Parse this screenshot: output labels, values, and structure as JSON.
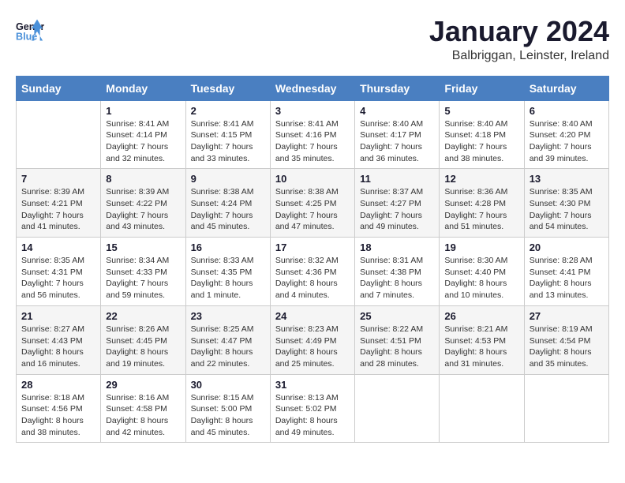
{
  "header": {
    "logo_line1": "General",
    "logo_line2": "Blue",
    "title": "January 2024",
    "subtitle": "Balbriggan, Leinster, Ireland"
  },
  "columns": [
    "Sunday",
    "Monday",
    "Tuesday",
    "Wednesday",
    "Thursday",
    "Friday",
    "Saturday"
  ],
  "weeks": [
    [
      {
        "day": "",
        "sunrise": "",
        "sunset": "",
        "daylight": ""
      },
      {
        "day": "1",
        "sunrise": "Sunrise: 8:41 AM",
        "sunset": "Sunset: 4:14 PM",
        "daylight": "Daylight: 7 hours and 32 minutes."
      },
      {
        "day": "2",
        "sunrise": "Sunrise: 8:41 AM",
        "sunset": "Sunset: 4:15 PM",
        "daylight": "Daylight: 7 hours and 33 minutes."
      },
      {
        "day": "3",
        "sunrise": "Sunrise: 8:41 AM",
        "sunset": "Sunset: 4:16 PM",
        "daylight": "Daylight: 7 hours and 35 minutes."
      },
      {
        "day": "4",
        "sunrise": "Sunrise: 8:40 AM",
        "sunset": "Sunset: 4:17 PM",
        "daylight": "Daylight: 7 hours and 36 minutes."
      },
      {
        "day": "5",
        "sunrise": "Sunrise: 8:40 AM",
        "sunset": "Sunset: 4:18 PM",
        "daylight": "Daylight: 7 hours and 38 minutes."
      },
      {
        "day": "6",
        "sunrise": "Sunrise: 8:40 AM",
        "sunset": "Sunset: 4:20 PM",
        "daylight": "Daylight: 7 hours and 39 minutes."
      }
    ],
    [
      {
        "day": "7",
        "sunrise": "Sunrise: 8:39 AM",
        "sunset": "Sunset: 4:21 PM",
        "daylight": "Daylight: 7 hours and 41 minutes."
      },
      {
        "day": "8",
        "sunrise": "Sunrise: 8:39 AM",
        "sunset": "Sunset: 4:22 PM",
        "daylight": "Daylight: 7 hours and 43 minutes."
      },
      {
        "day": "9",
        "sunrise": "Sunrise: 8:38 AM",
        "sunset": "Sunset: 4:24 PM",
        "daylight": "Daylight: 7 hours and 45 minutes."
      },
      {
        "day": "10",
        "sunrise": "Sunrise: 8:38 AM",
        "sunset": "Sunset: 4:25 PM",
        "daylight": "Daylight: 7 hours and 47 minutes."
      },
      {
        "day": "11",
        "sunrise": "Sunrise: 8:37 AM",
        "sunset": "Sunset: 4:27 PM",
        "daylight": "Daylight: 7 hours and 49 minutes."
      },
      {
        "day": "12",
        "sunrise": "Sunrise: 8:36 AM",
        "sunset": "Sunset: 4:28 PM",
        "daylight": "Daylight: 7 hours and 51 minutes."
      },
      {
        "day": "13",
        "sunrise": "Sunrise: 8:35 AM",
        "sunset": "Sunset: 4:30 PM",
        "daylight": "Daylight: 7 hours and 54 minutes."
      }
    ],
    [
      {
        "day": "14",
        "sunrise": "Sunrise: 8:35 AM",
        "sunset": "Sunset: 4:31 PM",
        "daylight": "Daylight: 7 hours and 56 minutes."
      },
      {
        "day": "15",
        "sunrise": "Sunrise: 8:34 AM",
        "sunset": "Sunset: 4:33 PM",
        "daylight": "Daylight: 7 hours and 59 minutes."
      },
      {
        "day": "16",
        "sunrise": "Sunrise: 8:33 AM",
        "sunset": "Sunset: 4:35 PM",
        "daylight": "Daylight: 8 hours and 1 minute."
      },
      {
        "day": "17",
        "sunrise": "Sunrise: 8:32 AM",
        "sunset": "Sunset: 4:36 PM",
        "daylight": "Daylight: 8 hours and 4 minutes."
      },
      {
        "day": "18",
        "sunrise": "Sunrise: 8:31 AM",
        "sunset": "Sunset: 4:38 PM",
        "daylight": "Daylight: 8 hours and 7 minutes."
      },
      {
        "day": "19",
        "sunrise": "Sunrise: 8:30 AM",
        "sunset": "Sunset: 4:40 PM",
        "daylight": "Daylight: 8 hours and 10 minutes."
      },
      {
        "day": "20",
        "sunrise": "Sunrise: 8:28 AM",
        "sunset": "Sunset: 4:41 PM",
        "daylight": "Daylight: 8 hours and 13 minutes."
      }
    ],
    [
      {
        "day": "21",
        "sunrise": "Sunrise: 8:27 AM",
        "sunset": "Sunset: 4:43 PM",
        "daylight": "Daylight: 8 hours and 16 minutes."
      },
      {
        "day": "22",
        "sunrise": "Sunrise: 8:26 AM",
        "sunset": "Sunset: 4:45 PM",
        "daylight": "Daylight: 8 hours and 19 minutes."
      },
      {
        "day": "23",
        "sunrise": "Sunrise: 8:25 AM",
        "sunset": "Sunset: 4:47 PM",
        "daylight": "Daylight: 8 hours and 22 minutes."
      },
      {
        "day": "24",
        "sunrise": "Sunrise: 8:23 AM",
        "sunset": "Sunset: 4:49 PM",
        "daylight": "Daylight: 8 hours and 25 minutes."
      },
      {
        "day": "25",
        "sunrise": "Sunrise: 8:22 AM",
        "sunset": "Sunset: 4:51 PM",
        "daylight": "Daylight: 8 hours and 28 minutes."
      },
      {
        "day": "26",
        "sunrise": "Sunrise: 8:21 AM",
        "sunset": "Sunset: 4:53 PM",
        "daylight": "Daylight: 8 hours and 31 minutes."
      },
      {
        "day": "27",
        "sunrise": "Sunrise: 8:19 AM",
        "sunset": "Sunset: 4:54 PM",
        "daylight": "Daylight: 8 hours and 35 minutes."
      }
    ],
    [
      {
        "day": "28",
        "sunrise": "Sunrise: 8:18 AM",
        "sunset": "Sunset: 4:56 PM",
        "daylight": "Daylight: 8 hours and 38 minutes."
      },
      {
        "day": "29",
        "sunrise": "Sunrise: 8:16 AM",
        "sunset": "Sunset: 4:58 PM",
        "daylight": "Daylight: 8 hours and 42 minutes."
      },
      {
        "day": "30",
        "sunrise": "Sunrise: 8:15 AM",
        "sunset": "Sunset: 5:00 PM",
        "daylight": "Daylight: 8 hours and 45 minutes."
      },
      {
        "day": "31",
        "sunrise": "Sunrise: 8:13 AM",
        "sunset": "Sunset: 5:02 PM",
        "daylight": "Daylight: 8 hours and 49 minutes."
      },
      {
        "day": "",
        "sunrise": "",
        "sunset": "",
        "daylight": ""
      },
      {
        "day": "",
        "sunrise": "",
        "sunset": "",
        "daylight": ""
      },
      {
        "day": "",
        "sunrise": "",
        "sunset": "",
        "daylight": ""
      }
    ]
  ]
}
